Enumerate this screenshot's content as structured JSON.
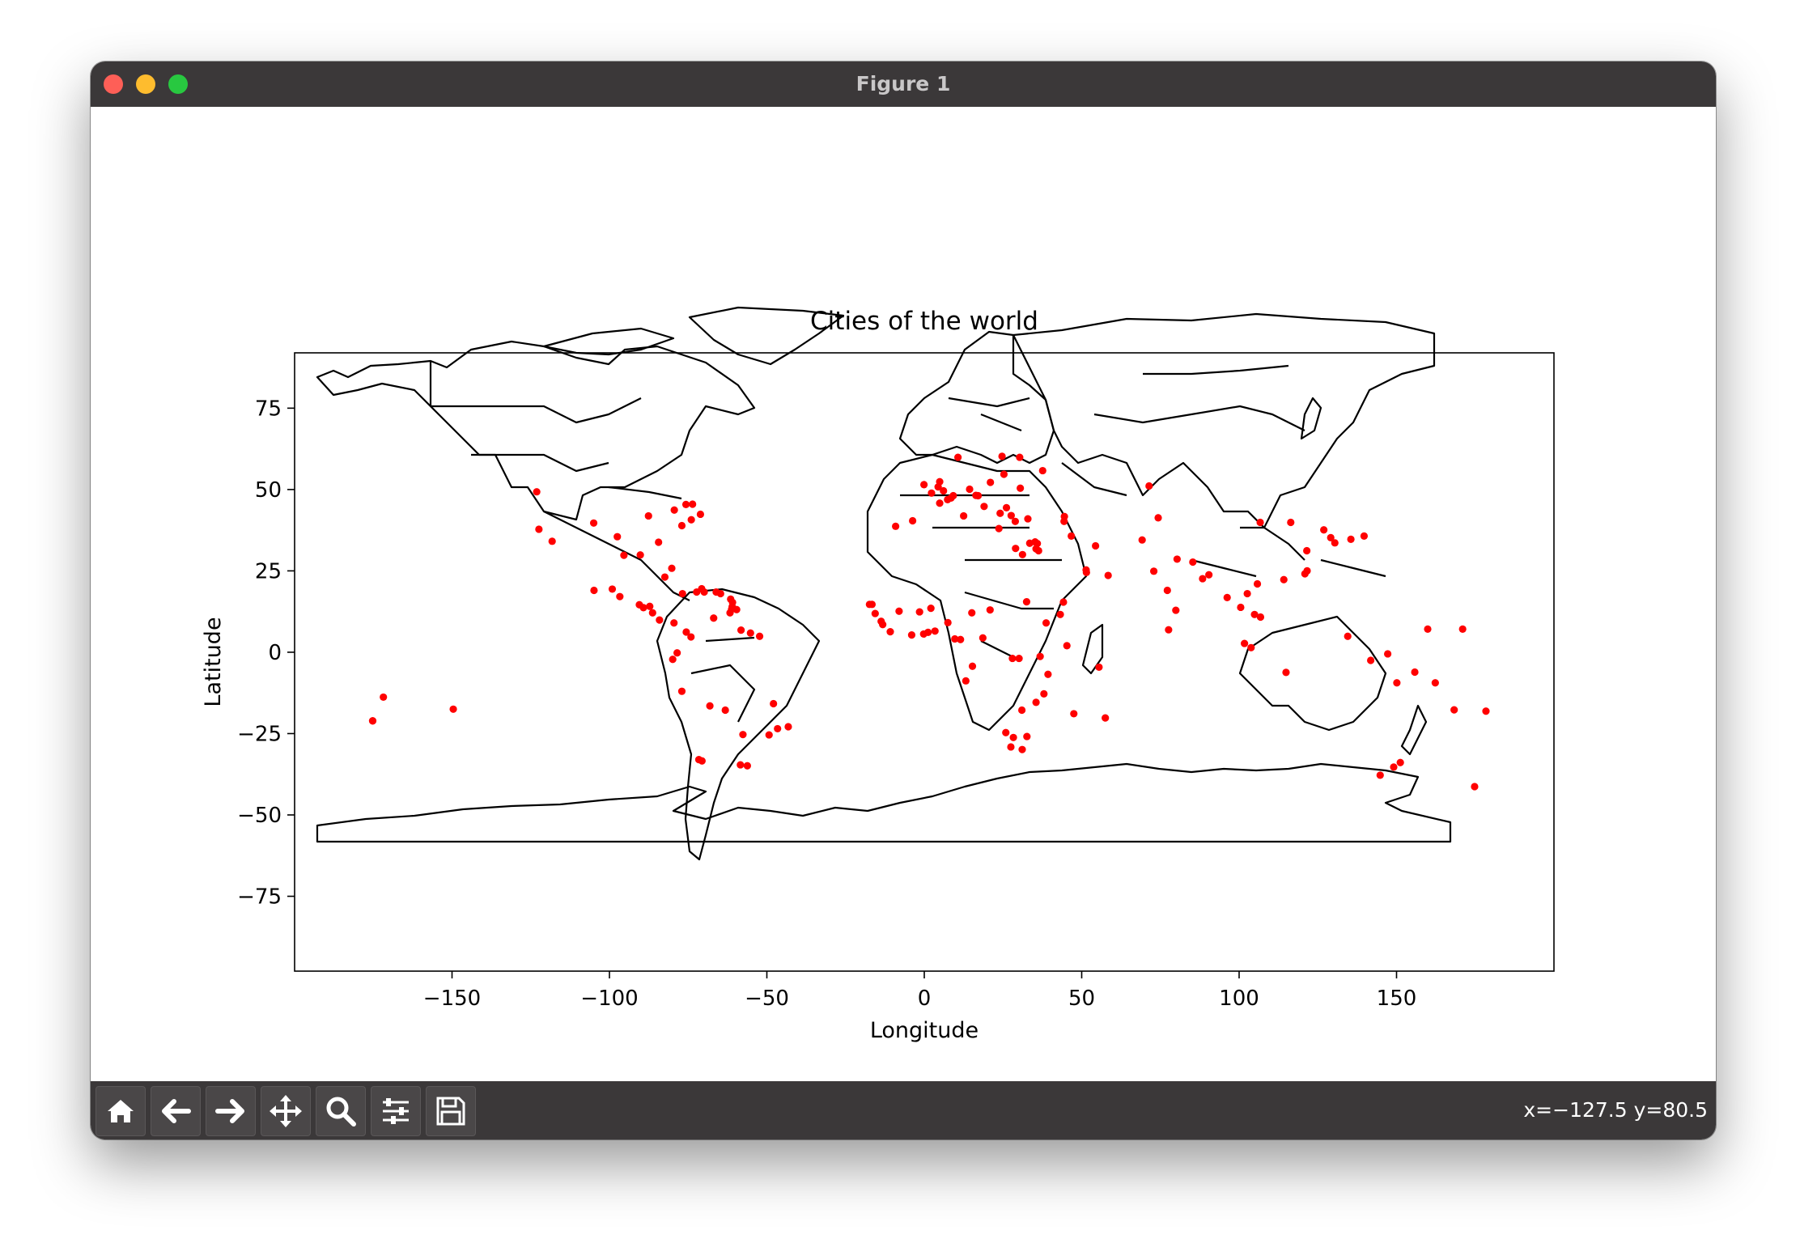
{
  "window": {
    "title": "Figure 1"
  },
  "toolbar": {
    "buttons": [
      {
        "name": "home-button",
        "icon": "home-icon"
      },
      {
        "name": "back-button",
        "icon": "arrow-left-icon"
      },
      {
        "name": "forward-button",
        "icon": "arrow-right-icon"
      },
      {
        "name": "pan-button",
        "icon": "move-icon"
      },
      {
        "name": "zoom-button",
        "icon": "magnifier-icon"
      },
      {
        "name": "configure-subplots-button",
        "icon": "sliders-icon"
      },
      {
        "name": "save-button",
        "icon": "floppy-disk-icon"
      }
    ],
    "coords": "x=−127.5 y=80.5"
  },
  "colors": {
    "titlebar": "#3b3839",
    "points": "#ff0000",
    "outline": "#000000"
  },
  "chart_data": {
    "type": "scatter",
    "title": "Cities of the world",
    "xlabel": "Longitude",
    "ylabel": "Latitude",
    "xlim": [
      -200,
      200
    ],
    "ylim": [
      -98,
      92
    ],
    "xticks": [
      -150,
      -100,
      -50,
      0,
      50,
      100,
      150
    ],
    "yticks": [
      75,
      50,
      25,
      0,
      -25,
      -50,
      -75
    ],
    "xtick_labels": [
      "−150",
      "−100",
      "−50",
      "0",
      "50",
      "100",
      "150"
    ],
    "ytick_labels": [
      "75",
      "50",
      "25",
      "0",
      "−25",
      "−50",
      "−75"
    ],
    "grid": false,
    "series": [
      {
        "color": "#ff0000",
        "x": [
          -123.1,
          -122.4,
          -118.2,
          -105,
          -104.9,
          -97.5,
          -95.4,
          -90.2,
          -87.6,
          -84.4,
          -80.2,
          -79.4,
          -77.0,
          -75.7,
          -74.0,
          -73.6,
          -71.1,
          -99.1,
          -96.7,
          -90.5,
          -89.2,
          -87.2,
          -86.3,
          -84.1,
          -79.5,
          -82.4,
          -76.8,
          -72.3,
          -70.7,
          -69.9,
          -66.1,
          -64.7,
          -61.5,
          -61.2,
          -61.0,
          -60.9,
          -61.7,
          -59.6,
          -58.2,
          -55.2,
          -52.3,
          -66.9,
          -74.1,
          -75.6,
          -78.5,
          -79.9,
          -77.0,
          -68.1,
          -63.2,
          -57.6,
          -56.2,
          -58.4,
          -70.6,
          -71.6,
          -47.9,
          -43.2,
          -46.6,
          -49.3,
          -175.2,
          -171.8,
          -149.6,
          -16.6,
          -17.4,
          -15.6,
          -13.7,
          -13.2,
          -10.8,
          -8.0,
          -4.0,
          -1.5,
          -0.2,
          1.2,
          2.1,
          3.4,
          7.5,
          9.7,
          11.5,
          13.2,
          15.3,
          18.6,
          15.1,
          20.9,
          31.2,
          32.5,
          38.7,
          36.8,
          39.3,
          32.6,
          30.1,
          28.0,
          35.5,
          25.9,
          31.0,
          28.3,
          31.1,
          27.5,
          38.0,
          47.5,
          45.3,
          57.5,
          55.5,
          43.2,
          44.2,
          -9.1,
          -3.7,
          2.3,
          -0.1,
          4.9,
          4.4,
          6.1,
          4.9,
          7.4,
          8.5,
          9.2,
          10.7,
          12.5,
          14.4,
          16.4,
          17.1,
          19.0,
          21.0,
          24.1,
          25.3,
          30.3,
          37.6,
          23.7,
          24.7,
          26.1,
          27.6,
          30.5,
          28.9,
          32.9,
          29.0,
          33.5,
          35.5,
          35.2,
          35.9,
          36.3,
          44.4,
          44.5,
          46.7,
          51.4,
          51.5,
          54.4,
          58.4,
          69.2,
          71.4,
          74.3,
          72.9,
          77.2,
          80.3,
          77.6,
          79.9,
          85.3,
          88.4,
          90.4,
          96.2,
          100.5,
          102.6,
          105.8,
          106.7,
          104.9,
          101.7,
          103.8,
          106.8,
          114.2,
          116.4,
          121.5,
          121.6,
          120.9,
          126.9,
          129.1,
          139.7,
          135.5,
          130.4,
          144.8,
          151.2,
          149.1,
          174.8,
          178.4,
          -175.2,
          171.0,
          168.3,
          159.9,
          147.2,
          134.5,
          162.3,
          114.9,
          150.1,
          155.8,
          141.8
        ],
        "y": [
          49.3,
          37.8,
          34.1,
          39.7,
          19.0,
          35.5,
          29.8,
          29.9,
          41.9,
          33.8,
          25.8,
          43.7,
          38.9,
          45.4,
          40.7,
          45.5,
          42.4,
          19.4,
          17.1,
          14.6,
          13.7,
          14.1,
          12.1,
          9.9,
          9.0,
          23.1,
          18.0,
          18.5,
          19.5,
          18.5,
          18.5,
          18.0,
          16.3,
          13.2,
          14.0,
          15.3,
          12.1,
          13.1,
          6.8,
          5.9,
          4.9,
          10.5,
          4.7,
          6.2,
          -0.2,
          -2.2,
          -12.0,
          -16.5,
          -17.8,
          -25.3,
          -34.9,
          -34.6,
          -33.4,
          -33.0,
          -15.8,
          -22.9,
          -23.5,
          -25.4,
          -21.1,
          -13.8,
          -17.5,
          14.7,
          14.7,
          11.9,
          9.5,
          8.5,
          6.3,
          12.6,
          5.3,
          12.4,
          5.6,
          6.1,
          13.5,
          6.5,
          9.1,
          4.1,
          3.9,
          -8.8,
          -4.3,
          4.4,
          12.1,
          13.0,
          30.0,
          15.5,
          9.0,
          -1.3,
          -6.8,
          -25.9,
          -1.9,
          -1.9,
          -15.4,
          -24.7,
          -17.8,
          -26.2,
          -29.9,
          -29.1,
          -12.8,
          -18.9,
          2.0,
          -20.2,
          -4.6,
          11.6,
          15.4,
          38.7,
          40.4,
          48.9,
          51.5,
          52.4,
          50.8,
          49.6,
          45.8,
          46.9,
          47.4,
          48.1,
          59.9,
          41.9,
          50.1,
          48.2,
          48.1,
          44.8,
          52.2,
          42.7,
          54.7,
          59.9,
          55.8,
          38.0,
          60.2,
          44.4,
          42.0,
          50.4,
          40.2,
          41.0,
          31.9,
          33.5,
          31.8,
          33.9,
          33.4,
          31.2,
          40.2,
          41.7,
          35.7,
          25.3,
          24.5,
          32.7,
          23.6,
          34.5,
          51.1,
          41.3,
          24.9,
          19.0,
          28.6,
          6.9,
          12.9,
          27.7,
          22.6,
          23.8,
          16.8,
          13.8,
          18.0,
          21.0,
          39.9,
          11.6,
          2.7,
          1.4,
          10.8,
          22.3,
          39.9,
          31.2,
          25.0,
          24.1,
          37.6,
          35.2,
          35.7,
          34.7,
          33.6,
          -37.8,
          -33.9,
          -35.3,
          -41.3,
          -18.1,
          -21.1,
          7.1,
          -17.7,
          7.1,
          -0.5,
          4.9,
          -9.4,
          -6.2,
          -9.4,
          -6.1,
          -2.5
        ]
      }
    ]
  }
}
